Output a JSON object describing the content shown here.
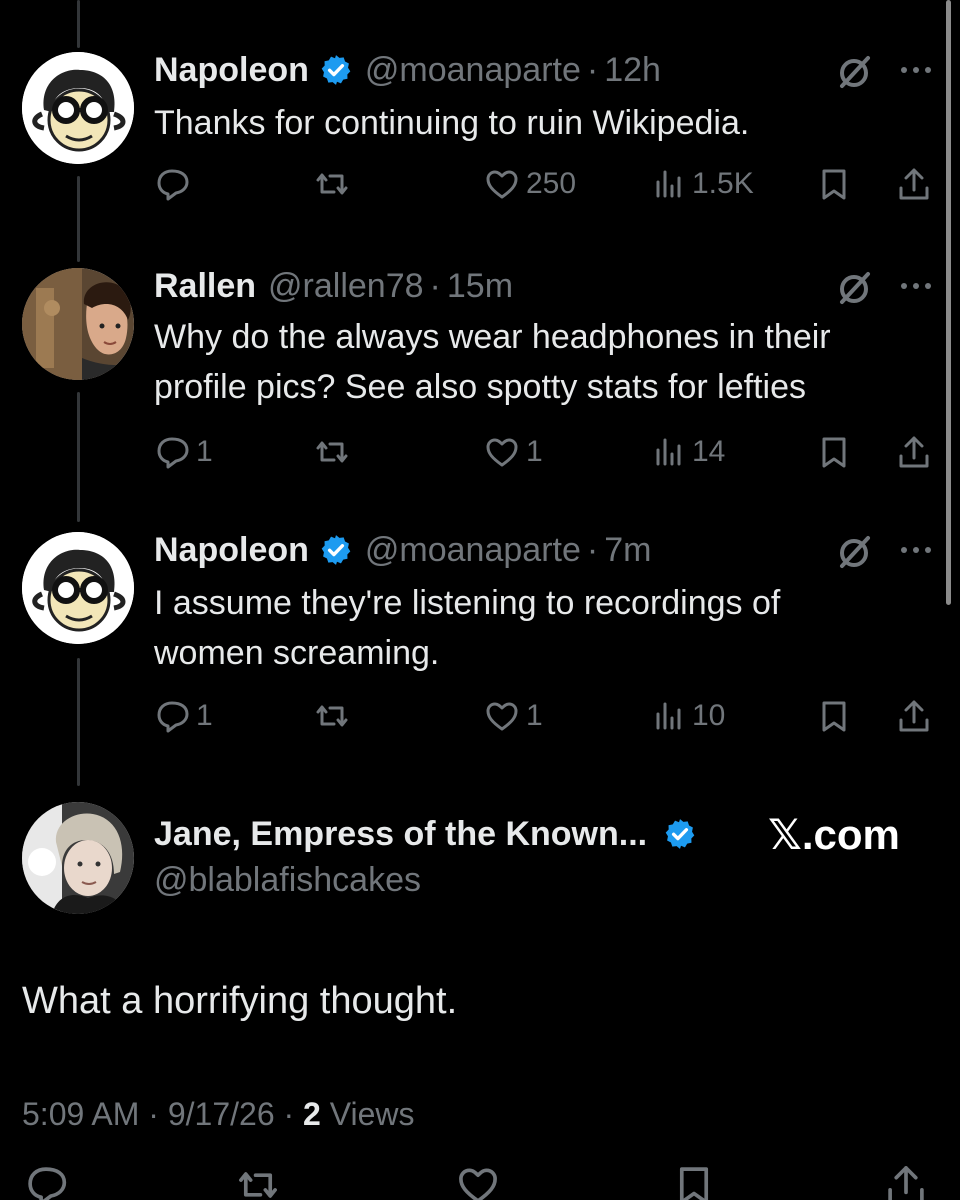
{
  "tweets": [
    {
      "name": "Napoleon",
      "verified": true,
      "handle": "@moanaparte",
      "dot": "·",
      "time": "12h",
      "text_lines": [
        "Thanks for continuing to ruin Wikipedia."
      ],
      "stats": {
        "replies": "",
        "reposts": "",
        "likes": "250",
        "views": "1.5K"
      },
      "avatar": "glasses-cartoon-avatar"
    },
    {
      "name": "Rallen",
      "verified": false,
      "handle": "@rallen78",
      "dot": "·",
      "time": "15m",
      "text_lines": [
        "Why do the always wear headphones in their",
        "profile pics? See also spotty stats for lefties"
      ],
      "stats": {
        "replies": "1",
        "reposts": "",
        "likes": "1",
        "views": "14"
      },
      "avatar": "photo-avatar"
    },
    {
      "name": "Napoleon",
      "verified": true,
      "handle": "@moanaparte",
      "dot": "·",
      "time": "7m",
      "text_lines": [
        "I assume they're listening to recordings of",
        "women screaming."
      ],
      "stats": {
        "replies": "1",
        "reposts": "",
        "likes": "1",
        "views": "10"
      },
      "avatar": "glasses-cartoon-avatar"
    }
  ],
  "main_tweet": {
    "name": "Jane, Empress of the Known...",
    "verified": true,
    "handle": "@blablafishcakes",
    "watermark": "𝕏.com",
    "text": "What a horrifying thought.",
    "time": "5:09 AM",
    "dot": "·",
    "date": "9/17/26",
    "views_count": "2",
    "views_label": "Views"
  },
  "colors": {
    "background": "#000000",
    "text": "#e7e9ea",
    "muted": "#71767b",
    "verified_blue": "#1d9bf0"
  },
  "icons": [
    "verified-badge-icon",
    "grok-icon",
    "more-icon",
    "reply-icon",
    "repost-icon",
    "like-icon",
    "views-icon",
    "bookmark-icon",
    "share-icon"
  ]
}
